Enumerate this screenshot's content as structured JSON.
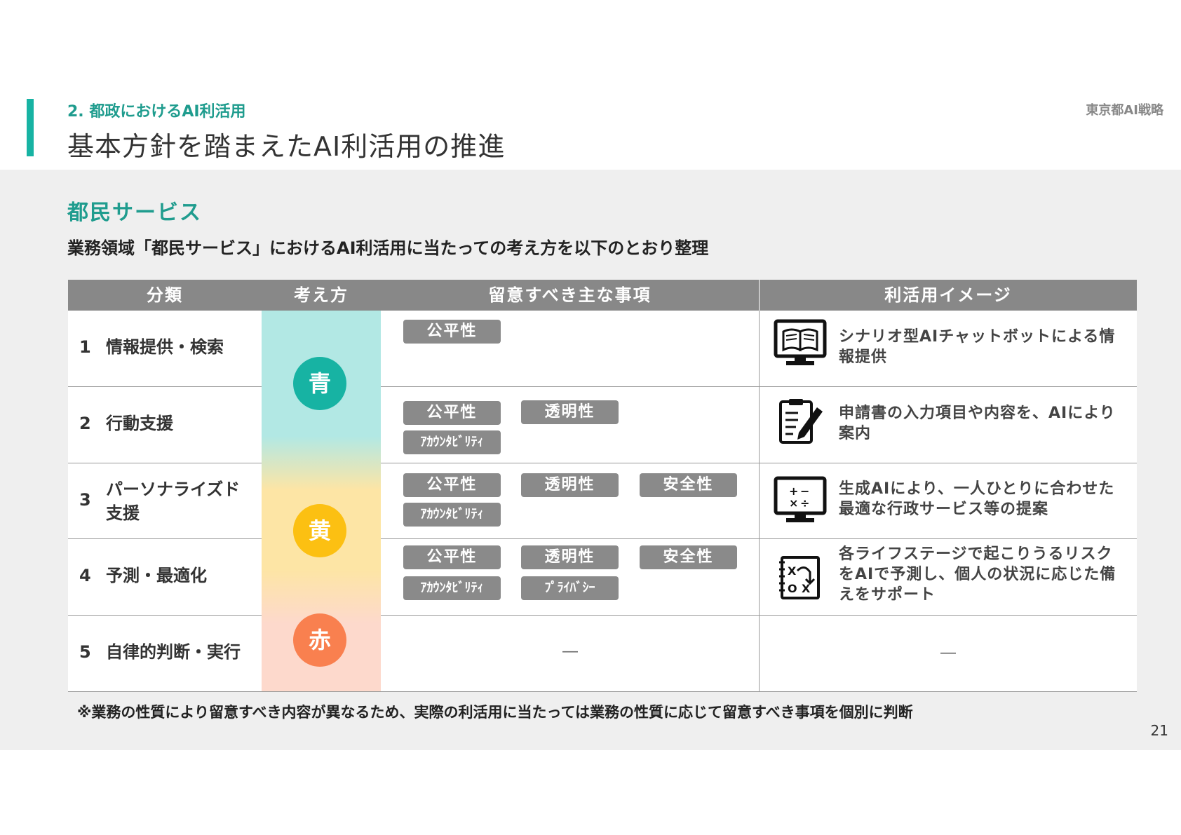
{
  "header": {
    "section": "2. 都政におけるAI利活用",
    "title": "基本方針を踏まえたAI利活用の推進",
    "org": "東京都AI戦略"
  },
  "body": {
    "heading": "都民サービス",
    "lead": "業務領域「都民サービス」におけるAI利活用に当たっての考え方を以下のとおり整理"
  },
  "table": {
    "headers": {
      "category": "分類",
      "approach": "考え方",
      "considerations": "留意すべき主な事項",
      "usage": "利活用イメージ"
    },
    "levels": [
      {
        "label": "青",
        "color": "#17b3a3"
      },
      {
        "label": "黄",
        "color": "#fcc012"
      },
      {
        "label": "赤",
        "color": "#f9804f"
      }
    ],
    "rows": [
      {
        "num": "1",
        "category": "情報提供・検索",
        "usage": "シナリオ型AIチャットボットによる情報提供"
      },
      {
        "num": "2",
        "category": "行動支援",
        "usage": "申請書の入力項目や内容を、AIにより案内"
      },
      {
        "num": "3",
        "category": "パーソナライズド支援",
        "category_line1": "パーソナライズド",
        "category_line2": "支援",
        "usage": "生成AIにより、一人ひとりに合わせた最適な行政サービス等の提案"
      },
      {
        "num": "4",
        "category": "予測・最適化",
        "usage": "各ライフステージで起こりうるリスクをAIで予測し、個人の状況に応じた備えをサポート"
      },
      {
        "num": "5",
        "category": "自律的判断・実行",
        "considerations_empty": "―",
        "usage_empty": "―"
      }
    ],
    "tags": {
      "fairness": "公平性",
      "transparency": "透明性",
      "safety": "安全性",
      "accountability": "ｱｶｳﾝﾀﾋﾞﾘﾃｨ",
      "privacy": "ﾌﾟﾗｲﾊﾞｼｰ"
    },
    "icons": [
      "book-monitor-icon",
      "clipboard-edit-icon",
      "calculator-monitor-icon",
      "strategy-board-icon"
    ]
  },
  "footnote": "※業務の性質により留意すべき内容が異なるため、実際の利活用に当たっては業務の性質に応じて留意すべき事項を個別に判断",
  "page_number": "21"
}
